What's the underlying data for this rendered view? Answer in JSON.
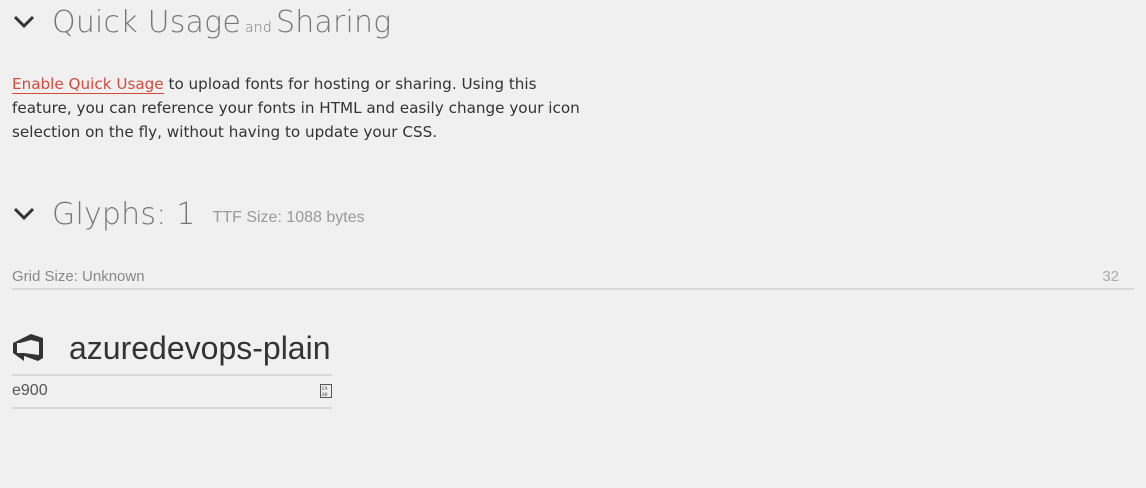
{
  "quick_usage": {
    "title_part1": "Quick Usage",
    "title_and": "and",
    "title_part2": "Sharing",
    "link_text": "Enable Quick Usage",
    "description": " to upload fonts for hosting or sharing. Using this feature, you can reference your fonts in HTML and easily change your icon selection on the fly, without having to update your CSS."
  },
  "glyphs": {
    "title": "Glyphs: 1",
    "ttf_size": "TTF Size: 1088 bytes",
    "grid_size_label": "Grid Size: Unknown",
    "grid_size_value": "32",
    "items": [
      {
        "name": "azuredevops-plain",
        "code": "e900",
        "icon": "azure-devops-icon"
      }
    ]
  },
  "colors": {
    "link": "#d24a3c",
    "heading": "#777777",
    "background": "#f0f0f0"
  }
}
